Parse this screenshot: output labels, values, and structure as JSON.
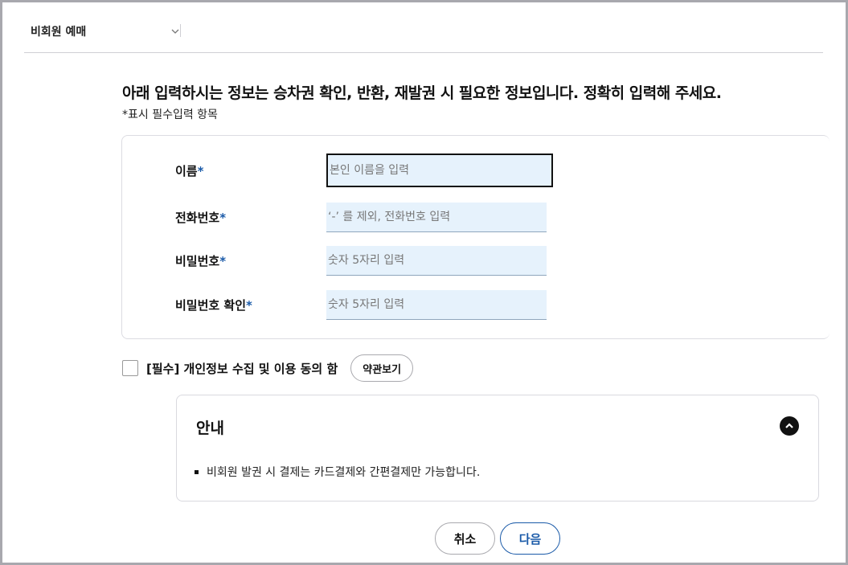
{
  "header": {
    "title": "비회원 예매",
    "dropdown_icon": "chevron-down-icon"
  },
  "notice": {
    "main": "아래 입력하시는 정보는 승차권 확인, 반환, 재발권 시 필요한 정보입니다. 정확히 입력해 주세요.",
    "required_note": "*표시 필수입력 항목"
  },
  "form": {
    "required_mark": "*",
    "name": {
      "label": "이름",
      "placeholder": "본인 이름을 입력",
      "value": ""
    },
    "phone": {
      "label": "전화번호",
      "placeholder": "‘-’ 를 제외, 전화번호 입력",
      "value": ""
    },
    "password": {
      "label": "비밀번호",
      "placeholder": "숫자 5자리 입력",
      "value": ""
    },
    "password_confirm": {
      "label": "비밀번호 확인",
      "placeholder": "숫자 5자리 입력",
      "value": ""
    }
  },
  "agreement": {
    "label": "[필수] 개인정보 수집 및 이용 동의 함",
    "terms_button": "약관보기",
    "checked": false
  },
  "guide": {
    "title": "안내",
    "toggle_icon": "chevron-up-circle-icon",
    "items": [
      "비회원 발권 시 결제는 카드결제와 간편결제만 가능합니다."
    ]
  },
  "actions": {
    "cancel": "취소",
    "next": "다음"
  },
  "colors": {
    "accent": "#1a5aa8",
    "input_bg": "#e6f2fc",
    "frame": "#a8a8ae"
  }
}
